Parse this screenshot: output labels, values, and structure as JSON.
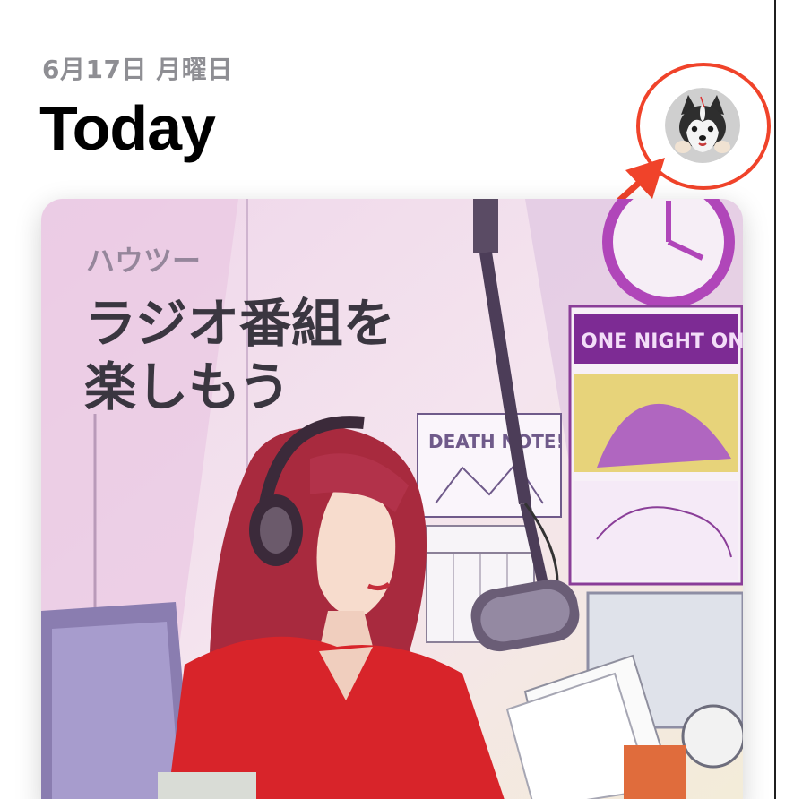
{
  "header": {
    "date": "6月17日 月曜日",
    "title": "Today"
  },
  "account": {
    "avatar_icon": "account-avatar-husky"
  },
  "annotation": {
    "color": "#f0432a"
  },
  "featured_card": {
    "category": "ハウツー",
    "title_line1": "ラジオ番組を",
    "title_line2": "楽しもう",
    "poster_text": "ONE NIGHT ONLY!",
    "poster2_text": "DEATH NOTE!"
  }
}
